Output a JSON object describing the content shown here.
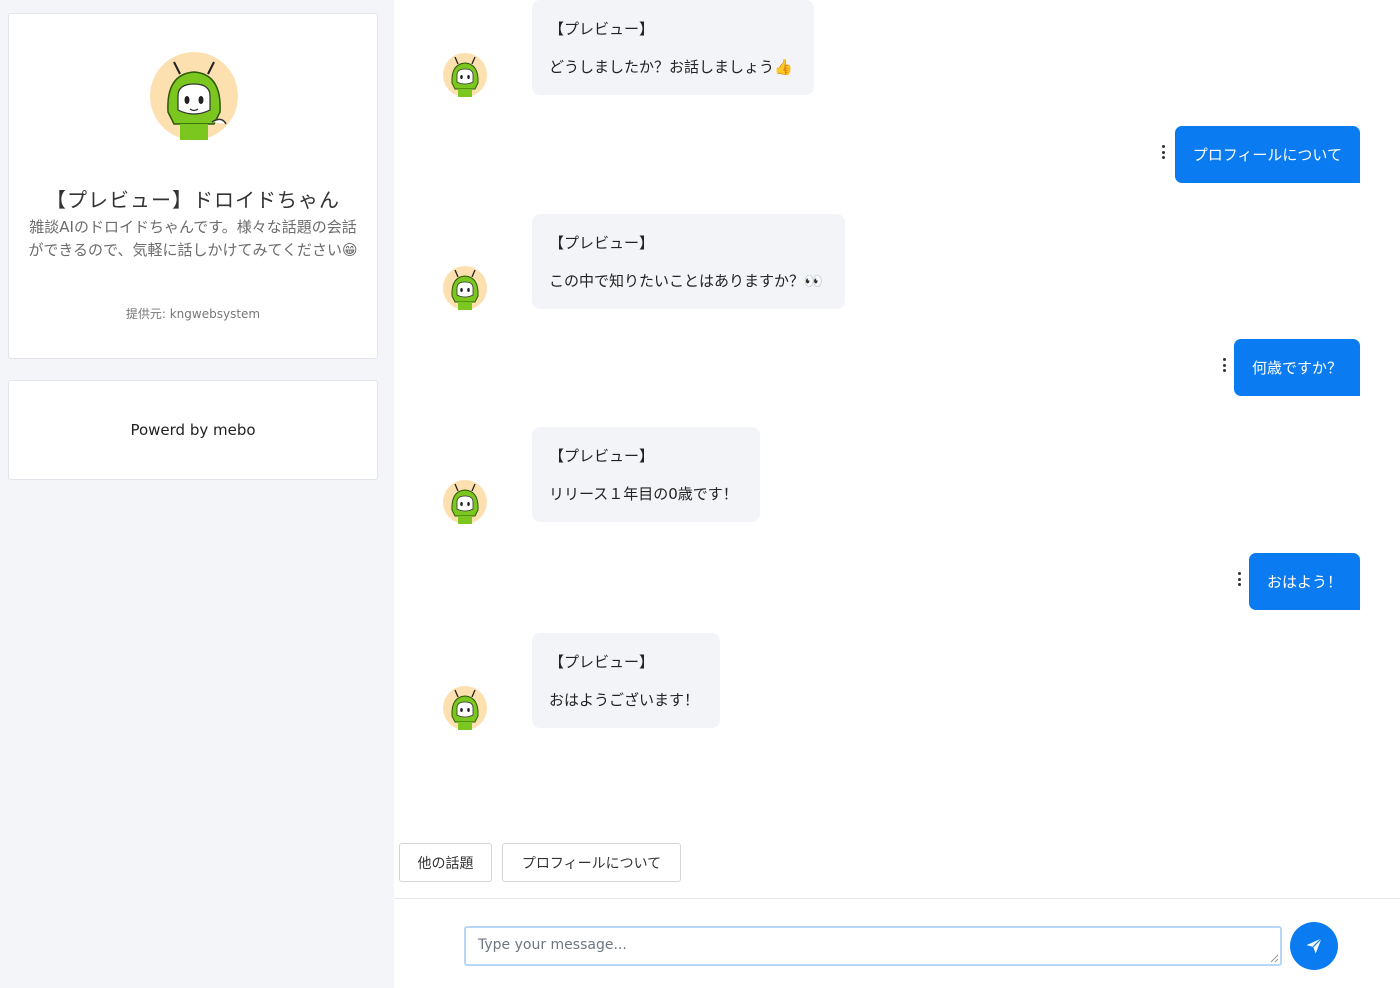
{
  "sidebar": {
    "profile": {
      "name": "【プレビュー】ドロイドちゃん",
      "description": "雑談AIのドロイドちゃんです。様々な話題の会話ができるので、気軽に話しかけてみてください😁",
      "provider": "提供元: kngwebsystem"
    },
    "powered_by": "Powerd by mebo"
  },
  "chat": {
    "messages": [
      {
        "sender": "bot",
        "name": "【プレビュー】",
        "text": "どうしましたか？お話しましょう👍"
      },
      {
        "sender": "user",
        "text": "プロフィールについて"
      },
      {
        "sender": "bot",
        "name": "【プレビュー】",
        "text": "この中で知りたいことはありますか？👀"
      },
      {
        "sender": "user",
        "text": "何歳ですか？"
      },
      {
        "sender": "bot",
        "name": "【プレビュー】",
        "text": "リリース１年目の0歳です！"
      },
      {
        "sender": "user",
        "text": "おはよう！"
      },
      {
        "sender": "bot",
        "name": "【プレビュー】",
        "text": "おはようございます！"
      }
    ],
    "quick_replies": [
      "他の話題",
      "プロフィールについて"
    ]
  },
  "composer": {
    "placeholder": "Type your message...",
    "value": ""
  },
  "colors": {
    "accent": "#0a7bf0",
    "sidebar_bg": "#f4f5f8",
    "bot_bubble": "#f3f4f7",
    "avatar_bg": "#fde0b0",
    "avatar_green": "#7bc61f"
  },
  "icons": {
    "avatar": "droid-chan-avatar",
    "more": "kebab-menu-icon",
    "send": "send-icon"
  }
}
